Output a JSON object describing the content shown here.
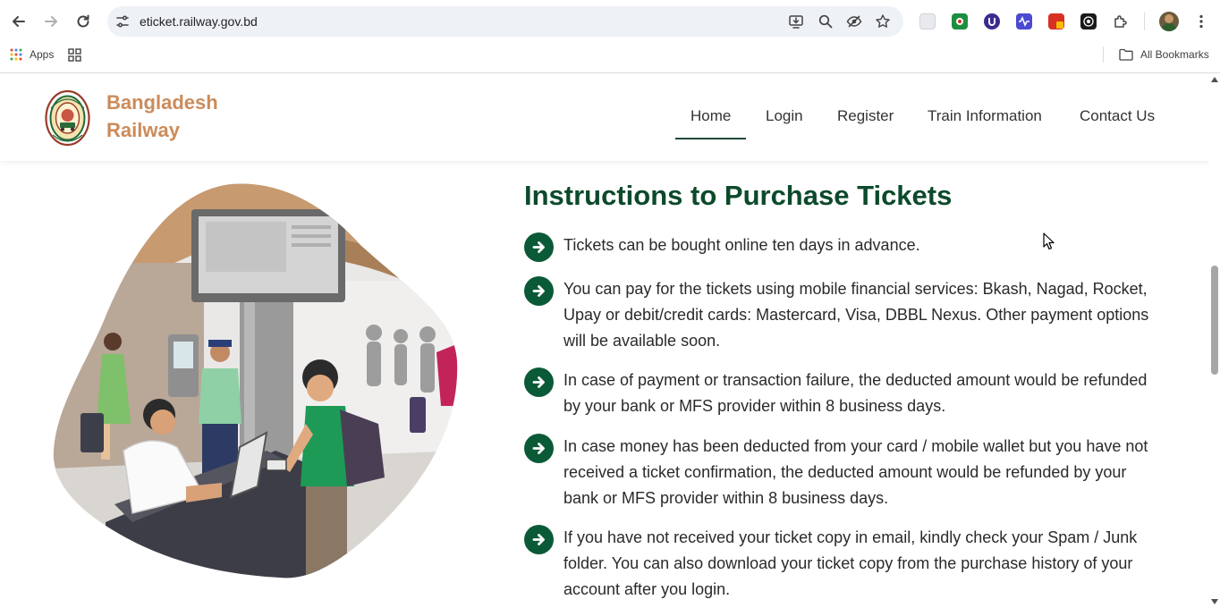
{
  "browser": {
    "url": "eticket.railway.gov.bd",
    "bookmarks": {
      "apps_label": "Apps",
      "all_bookmarks_label": "All Bookmarks"
    }
  },
  "site": {
    "brand": "Bangladesh Railway",
    "nav": [
      {
        "label": "Home",
        "active": true
      },
      {
        "label": "Login"
      },
      {
        "label": "Register"
      },
      {
        "label": "Train Information"
      },
      {
        "label": "Contact Us"
      }
    ]
  },
  "content": {
    "title": "Instructions to Purchase Tickets",
    "instructions": [
      "Tickets can be bought online ten days in advance.",
      "You can pay for the tickets using mobile financial services: Bkash, Nagad, Rocket, Upay or debit/credit cards: Mastercard, Visa, DBBL Nexus. Other payment options will be available soon.",
      "In case of payment or transaction failure, the deducted amount would be refunded by your bank or MFS provider within 8 business days.",
      "In case money has been deducted from your card / mobile wallet but you have not received a ticket confirmation, the deducted amount would be refunded by your bank or MFS provider within 8 business days.",
      "If you have not received your ticket copy in email, kindly check your Spam / Junk folder. You can also download your ticket copy from the purchase history of your account after you login."
    ]
  },
  "colors": {
    "brand": "#cb8b5a",
    "title": "#0c4a2b",
    "arrow_bg": "#0b5a37",
    "nav_active_underline": "#1f4a36"
  },
  "icons": {
    "toolbar": [
      "back-icon",
      "forward-icon",
      "reload-icon",
      "site-settings-icon",
      "install-icon",
      "zoom-icon",
      "eye-off-icon",
      "star-icon",
      "extensions-icon",
      "menu-icon"
    ],
    "instruction_bullet": "arrow-right-circle-icon"
  }
}
